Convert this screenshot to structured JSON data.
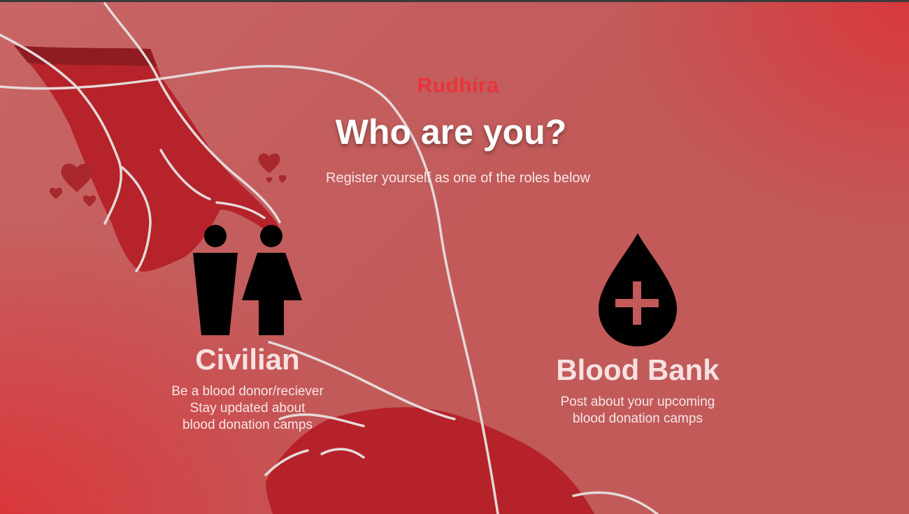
{
  "app": {
    "brand": "Rudhira"
  },
  "header": {
    "title": "Who are you?",
    "subtitle": "Register yourself as one of the roles below"
  },
  "roles": [
    {
      "key": "civilian",
      "icon": "people-icon",
      "title": "Civilian",
      "description_lines": [
        "Be a blood donor/reciever",
        "Stay updated about",
        "blood donation camps"
      ]
    },
    {
      "key": "blood_bank",
      "icon": "blood-drop-plus-icon",
      "title": "Blood Bank",
      "description_lines": [
        "Post about your upcoming",
        "blood donation camps"
      ]
    }
  ],
  "colors": {
    "background": "#c25a5a",
    "accent": "#e8343a",
    "hand": "#b52027",
    "outline": "#e6dada",
    "heart": "#a8282d",
    "icon": "#000000"
  }
}
